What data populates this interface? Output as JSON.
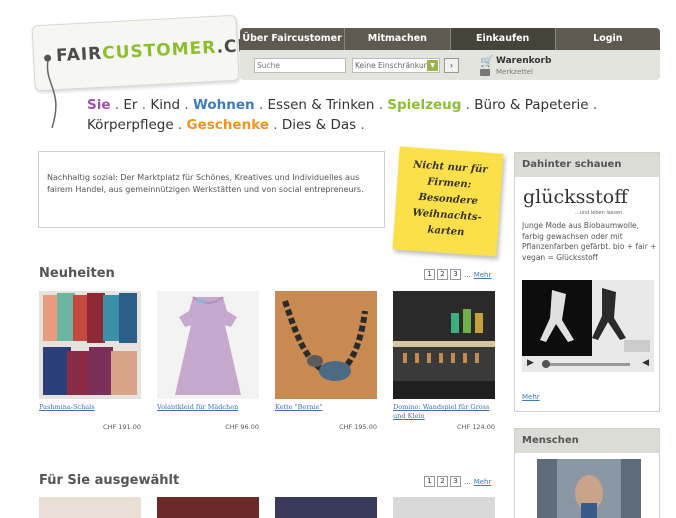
{
  "logo": {
    "text_pre": "FAIR",
    "text_accent": "CUSTOMER",
    "text_post": ".CH",
    "accent_color": "#8cbf2c"
  },
  "nav": {
    "items": [
      {
        "label": "Über Faircustomer"
      },
      {
        "label": "Mitmachen"
      },
      {
        "label": "Einkaufen"
      },
      {
        "label": "Login"
      }
    ],
    "search_placeholder": "Suche",
    "filter_value": "Keine Einschränkung",
    "go_label": "›",
    "cart_label": "Warenkorb",
    "wishlist_label": "Merkzettel"
  },
  "categories": [
    {
      "label": "Sie"
    },
    {
      "label": "Er"
    },
    {
      "label": "Kind"
    },
    {
      "label": "Wohnen"
    },
    {
      "label": "Essen & Trinken"
    },
    {
      "label": "Spielzeug"
    },
    {
      "label": "Büro & Papeterie"
    },
    {
      "label": "Körperpflege"
    },
    {
      "label": "Geschenke"
    },
    {
      "label": "Dies & Das"
    }
  ],
  "category_separator": " . ",
  "intro_text": "Nachhaltig sozial: Der Marktplatz für Schönes, Kreatives und Individuelles aus fairem Handel, aus gemeinnützigen Werkstätten und von social entrepreneurs.",
  "sticky_text": "Nicht nur für Firmen: Besondere Weihnachts-karten",
  "neuheiten": {
    "title": "Neuheiten",
    "pages": [
      "1",
      "2",
      "3"
    ],
    "dots": "...",
    "more": "Mehr",
    "products": [
      {
        "name": "Pashmina-Schals",
        "price": "CHF 191.00"
      },
      {
        "name": "Volantkleid für Mädchen",
        "price": "CHF 96.00"
      },
      {
        "name": "Kette \"Bernie\"",
        "price": "CHF 195.00"
      },
      {
        "name": "Domino: Wandspiel für Gross und Klein",
        "price": "CHF 124.00"
      }
    ]
  },
  "fuer_sie": {
    "title": "Für Sie ausgewählt",
    "pages": [
      "1",
      "2",
      "3"
    ],
    "dots": "...",
    "more": "Mehr"
  },
  "sidebar": {
    "dahinter_title": "Dahinter schauen",
    "brand_name": "glücksstoff",
    "brand_tagline": "...und leben lassen.",
    "brand_text": "Junge Mode aus Biobaumwolle, farbig gewachsen oder mit Pflanzenfarben gefärbt. bio + fair + vegan = Glücksstoff",
    "more": "Mehr",
    "menschen_title": "Menschen"
  },
  "colors": {
    "nav_bg": "#5e5a50",
    "link": "#3f7bbf",
    "sticky": "#fbe049"
  }
}
